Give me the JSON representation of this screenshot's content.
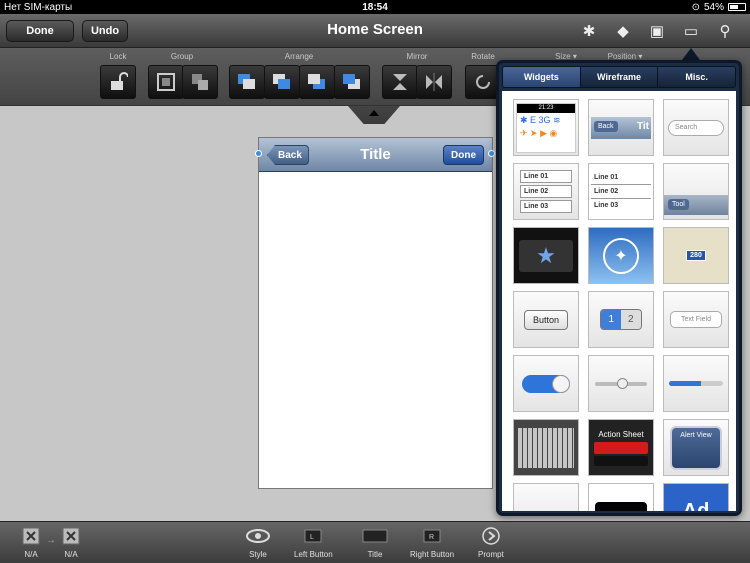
{
  "status": {
    "carrier": "Нет SIM-карты",
    "time": "18:54",
    "battery": "54%"
  },
  "nav": {
    "done": "Done",
    "undo": "Undo",
    "title": "Home Screen"
  },
  "toolbar": {
    "lock": "Lock",
    "group": "Group",
    "arrange": "Arrange",
    "mirror": "Mirror",
    "rotate": "Rotate",
    "size": "Size ▾",
    "position": "Position ▾"
  },
  "phone": {
    "back": "Back",
    "title": "Title",
    "done": "Done"
  },
  "popover": {
    "tabs": [
      "Widgets",
      "Wireframe",
      "Misc."
    ],
    "status_time": "21:23",
    "back": "Back",
    "tit": "Tit",
    "search": "Search",
    "lines": [
      "Line 01",
      "Line 02",
      "Line 03"
    ],
    "tool": "Tool",
    "map_label": "280",
    "button": "Button",
    "seg1": "1",
    "seg2": "2",
    "textfield": "Text Field",
    "action_sheet": "Action Sheet",
    "alert_view": "Alert View",
    "ad": "Ad"
  },
  "bottom": {
    "na1": "N/A",
    "na2": "N/A",
    "style": "Style",
    "left_button": "Left Button",
    "title": "Title",
    "right_button": "Right Button",
    "prompt": "Prompt"
  }
}
